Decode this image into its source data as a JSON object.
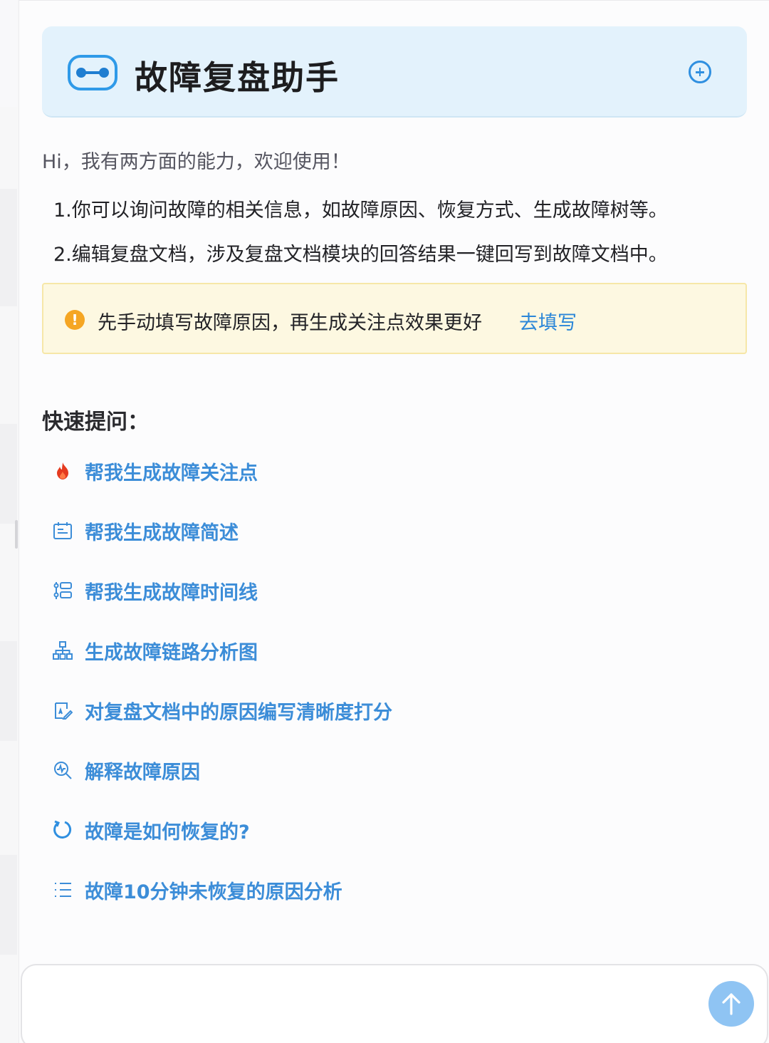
{
  "header": {
    "title": "故障复盘助手",
    "logo_icon": "link-icon",
    "add_icon": "plus-circle-icon"
  },
  "intro": {
    "greeting": "Hi，我有两方面的能力，欢迎使用！",
    "abilities": [
      "1.你可以询问故障的相关信息，如故障原因、恢复方式、生成故障树等。",
      "2.编辑复盘文档，涉及复盘文档模块的回答结果一键回写到故障文档中。"
    ]
  },
  "notice": {
    "icon": "warning-icon",
    "text": "先手动填写故障原因，再生成关注点效果更好",
    "link": "去填写"
  },
  "quick": {
    "title": "快速提问：",
    "items": [
      {
        "icon": "fire-icon",
        "label": "帮我生成故障关注点"
      },
      {
        "icon": "calendar-icon",
        "label": "帮我生成故障简述"
      },
      {
        "icon": "timeline-icon",
        "label": "帮我生成故障时间线"
      },
      {
        "icon": "hierarchy-icon",
        "label": "生成故障链路分析图"
      },
      {
        "icon": "document-score-icon",
        "label": "对复盘文档中的原因编写清晰度打分"
      },
      {
        "icon": "search-analyze-icon",
        "label": "解释故障原因"
      },
      {
        "icon": "refresh-icon",
        "label": "故障是如何恢复的?"
      },
      {
        "icon": "list-icon",
        "label": "故障10分钟未恢复的原因分析"
      }
    ]
  },
  "composer": {
    "send_icon": "arrow-up-icon"
  },
  "colors": {
    "accent": "#3c8dd8",
    "header_bg": "#e3f2fc",
    "notice_bg": "#fdf8e1",
    "warning": "#f5a623",
    "fire": "#e53a1f"
  }
}
